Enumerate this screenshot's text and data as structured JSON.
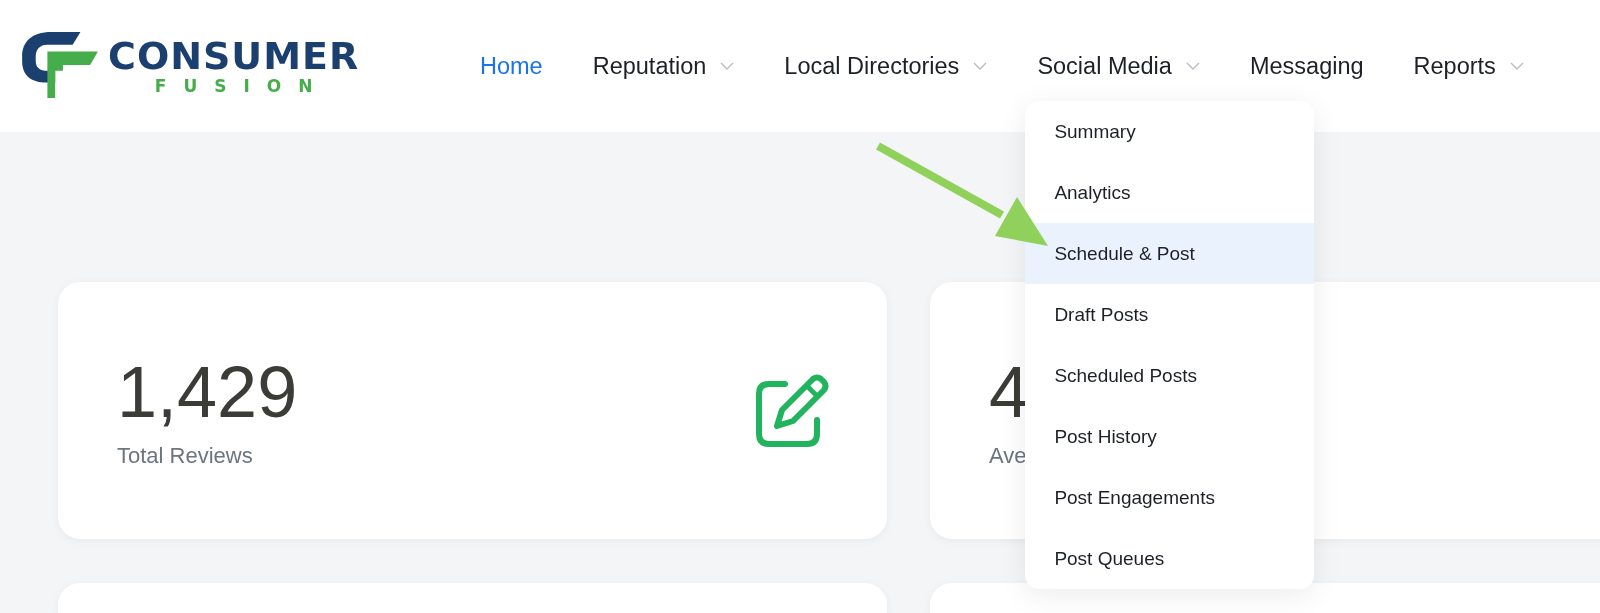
{
  "logo": {
    "name": "CONSUMER",
    "tagline": "FUSION"
  },
  "nav": [
    {
      "label": "Home",
      "selected": true,
      "has_menu": false
    },
    {
      "label": "Reputation",
      "selected": false,
      "has_menu": true
    },
    {
      "label": "Local Directories",
      "selected": false,
      "has_menu": true
    },
    {
      "label": "Social Media",
      "selected": false,
      "has_menu": true,
      "expanded": true,
      "menu": [
        {
          "label": "Summary",
          "selected": false
        },
        {
          "label": "Analytics",
          "selected": false
        },
        {
          "label": "Schedule & Post",
          "selected": true
        },
        {
          "label": "Draft Posts",
          "selected": false
        },
        {
          "label": "Scheduled Posts",
          "selected": false
        },
        {
          "label": "Post History",
          "selected": false
        },
        {
          "label": "Post Engagements",
          "selected": false
        },
        {
          "label": "Post Queues",
          "selected": false
        }
      ]
    },
    {
      "label": "Messaging",
      "selected": false,
      "has_menu": false
    },
    {
      "label": "Reports",
      "selected": false,
      "has_menu": true
    }
  ],
  "stats": [
    {
      "value": "1,429",
      "label": "Total Reviews",
      "kind": "icon"
    },
    {
      "value": "4",
      "label": "Ave",
      "kind": "plain"
    }
  ],
  "lower_cards": [
    {
      "kind": "blank"
    },
    {
      "kind": "blank"
    }
  ],
  "annotation": {
    "kind": "arrow"
  }
}
